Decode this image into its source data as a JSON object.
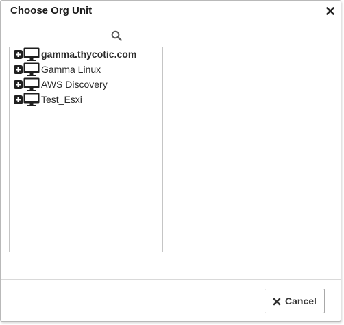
{
  "dialog": {
    "title": "Choose Org Unit",
    "close_icon": "close-icon"
  },
  "search": {
    "value": "",
    "placeholder": "",
    "icon": "search-icon"
  },
  "tree": {
    "items": [
      {
        "label": "gamma.thycotic.com",
        "bold": true,
        "icon": "monitor-icon",
        "expander": "plus-square-icon"
      },
      {
        "label": "Gamma Linux",
        "bold": false,
        "icon": "monitor-icon",
        "expander": "plus-square-icon"
      },
      {
        "label": "AWS Discovery",
        "bold": false,
        "icon": "monitor-icon",
        "expander": "plus-square-icon"
      },
      {
        "label": "Test_Esxi",
        "bold": false,
        "icon": "monitor-icon",
        "expander": "plus-square-icon"
      }
    ]
  },
  "footer": {
    "cancel_label": "Cancel",
    "cancel_icon": "x-icon"
  },
  "colors": {
    "text": "#2b2b2b",
    "icon": "#1a1a1a",
    "border": "#c5c5c5"
  }
}
